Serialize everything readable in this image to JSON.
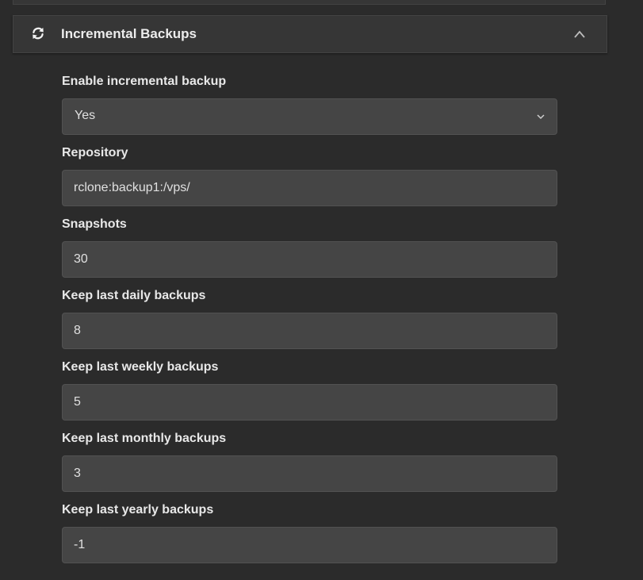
{
  "section": {
    "title": "Incremental Backups",
    "icon": "sync-icon",
    "collapse_icon": "chevron-up-icon"
  },
  "fields": [
    {
      "label": "Enable incremental backup",
      "type": "select",
      "value": "Yes"
    },
    {
      "label": "Repository",
      "type": "text",
      "value": "rclone:backup1:/vps/"
    },
    {
      "label": "Snapshots",
      "type": "text",
      "value": "30"
    },
    {
      "label": "Keep last daily backups",
      "type": "text",
      "value": "8"
    },
    {
      "label": "Keep last weekly backups",
      "type": "text",
      "value": "5"
    },
    {
      "label": "Keep last monthly backups",
      "type": "text",
      "value": "3"
    },
    {
      "label": "Keep last yearly backups",
      "type": "text",
      "value": "-1"
    }
  ],
  "colors": {
    "background": "#2b2b2b",
    "panel": "#363636",
    "input": "#454545",
    "text": "#e6e6e6"
  }
}
